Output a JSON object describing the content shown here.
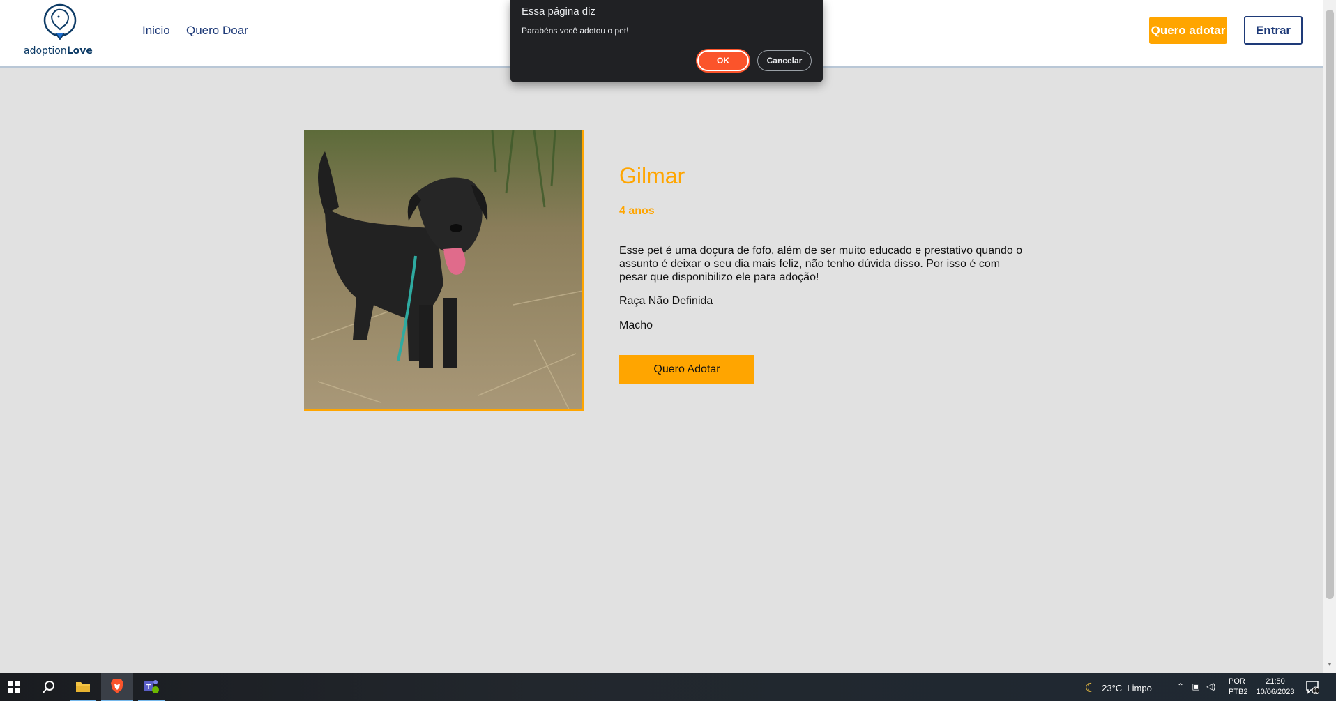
{
  "header": {
    "logo_text_light": "adoption",
    "logo_text_bold": "Love",
    "nav": [
      "Inicio",
      "Quero Doar"
    ],
    "cta_button": "Quero adotar",
    "login_button": "Entrar"
  },
  "pet": {
    "name": "Gilmar",
    "age": "4 anos",
    "description": "Esse pet é uma doçura de fofo, além de ser muito educado e prestativo quando o assunto é deixar o seu dia mais feliz, não tenho dúvida disso. Por isso é com pesar que disponibilizo ele para adoção!",
    "breed": "Raça Não Definida",
    "sex": "Macho",
    "adopt_button": "Quero Adotar"
  },
  "dialog": {
    "title": "Essa página diz",
    "message": "Parabéns você adotou o pet!",
    "ok_label": "OK",
    "cancel_label": "Cancelar"
  },
  "taskbar": {
    "weather": "23°C  Limpo",
    "lang_line1": "POR",
    "lang_line2": "PTB2",
    "time": "21:50",
    "date": "10/06/2023",
    "notification_count": "1"
  },
  "colors": {
    "accent": "#ffa500",
    "navy": "#1e3a78",
    "page_bg": "#e1e1e1",
    "dialog_bg": "#202124",
    "dialog_ok": "#fb542b"
  }
}
